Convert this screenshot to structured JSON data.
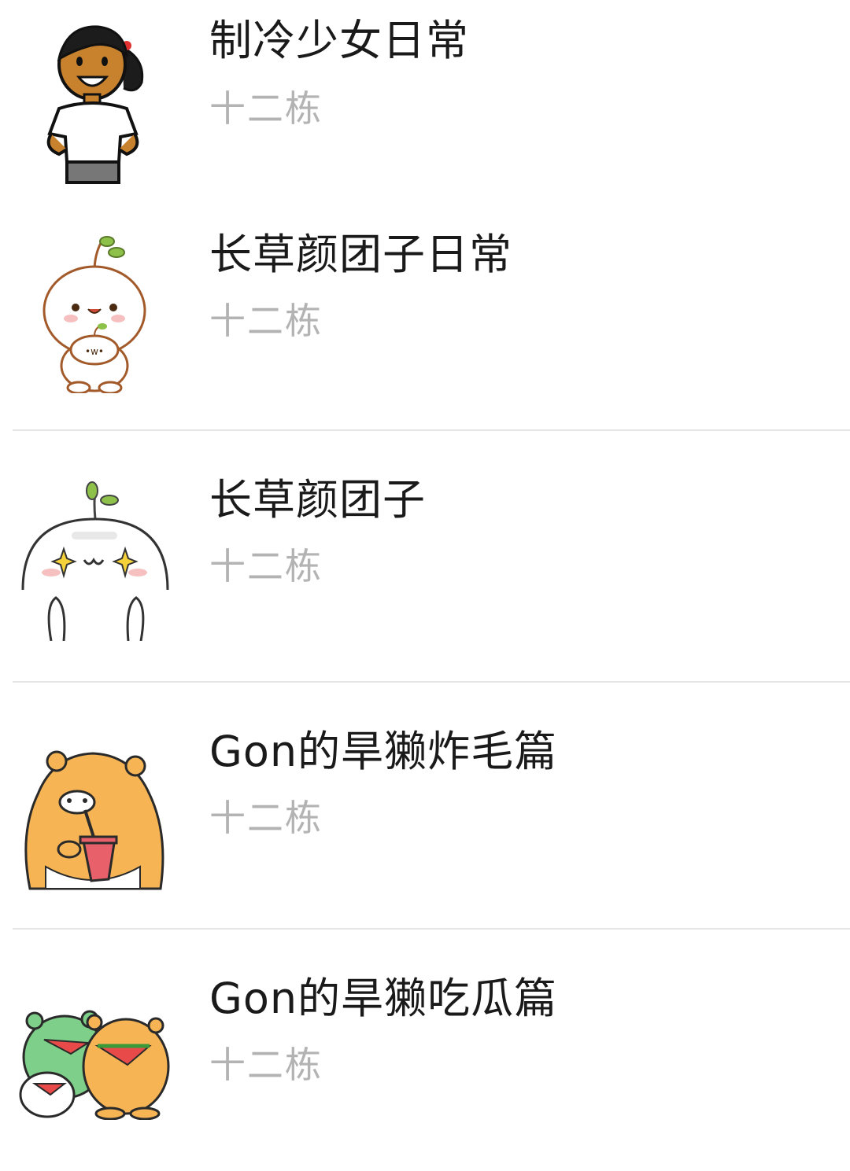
{
  "sticker_list": {
    "items": [
      {
        "title": "制冷少女日常",
        "author": "十二栋",
        "thumbnail": "sticker-girl-icon"
      },
      {
        "title": "长草颜团子日常",
        "author": "十二栋",
        "thumbnail": "sticker-sprout-dumpling-icon"
      },
      {
        "title": "长草颜团子",
        "author": "十二栋",
        "thumbnail": "sticker-sprout-dumpling-sparkle-icon"
      },
      {
        "title": "Gon的旱獭炸毛篇",
        "author": "十二栋",
        "thumbnail": "sticker-marmot-drink-icon"
      },
      {
        "title": "Gon的旱獭吃瓜篇",
        "author": "十二栋",
        "thumbnail": "sticker-marmot-watermelon-icon"
      }
    ]
  }
}
